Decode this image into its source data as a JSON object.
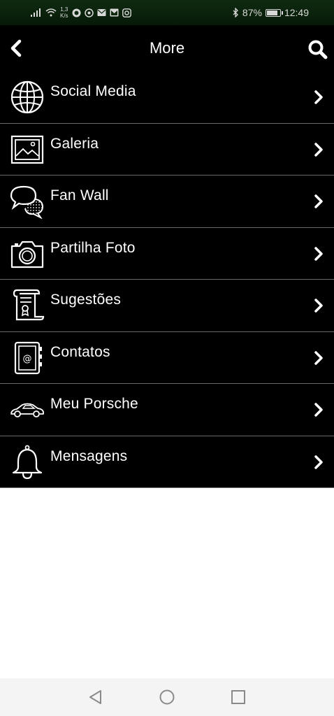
{
  "status_bar": {
    "speed_value": "1,3",
    "speed_unit": "K/s",
    "battery": "87%",
    "battery_level": 0.87,
    "time": "12:49",
    "icons": [
      "signal-icon",
      "wifi-icon",
      "whatsapp-icon",
      "whatsapp-business-icon",
      "mail-icon",
      "gmail-icon",
      "instagram-icon",
      "bluetooth-icon",
      "battery-icon"
    ]
  },
  "header": {
    "title": "More",
    "back_icon": "chevron-left-icon",
    "search_icon": "search-icon"
  },
  "menu": {
    "items": [
      {
        "label": "Social Media",
        "icon": "globe-icon"
      },
      {
        "label": "Galeria",
        "icon": "picture-icon"
      },
      {
        "label": "Fan Wall",
        "icon": "speech-bubbles-icon"
      },
      {
        "label": "Partilha Foto",
        "icon": "camera-icon"
      },
      {
        "label": "Sugestões",
        "icon": "scroll-certificate-icon"
      },
      {
        "label": "Contatos",
        "icon": "address-book-icon"
      },
      {
        "label": "Meu Porsche",
        "icon": "car-icon"
      },
      {
        "label": "Mensagens",
        "icon": "bell-icon"
      }
    ]
  },
  "nav_bar": {
    "buttons": [
      "back-triangle-icon",
      "home-circle-icon",
      "recents-square-icon"
    ]
  },
  "colors": {
    "status_bar_bg": "#0f2a10",
    "header_bg": "#000000",
    "list_bg": "#000000",
    "divider": "#6a6a6a",
    "text": "#ffffff",
    "page_bg": "#ffffff",
    "nav_bar_bg": "#f4f4f4"
  }
}
